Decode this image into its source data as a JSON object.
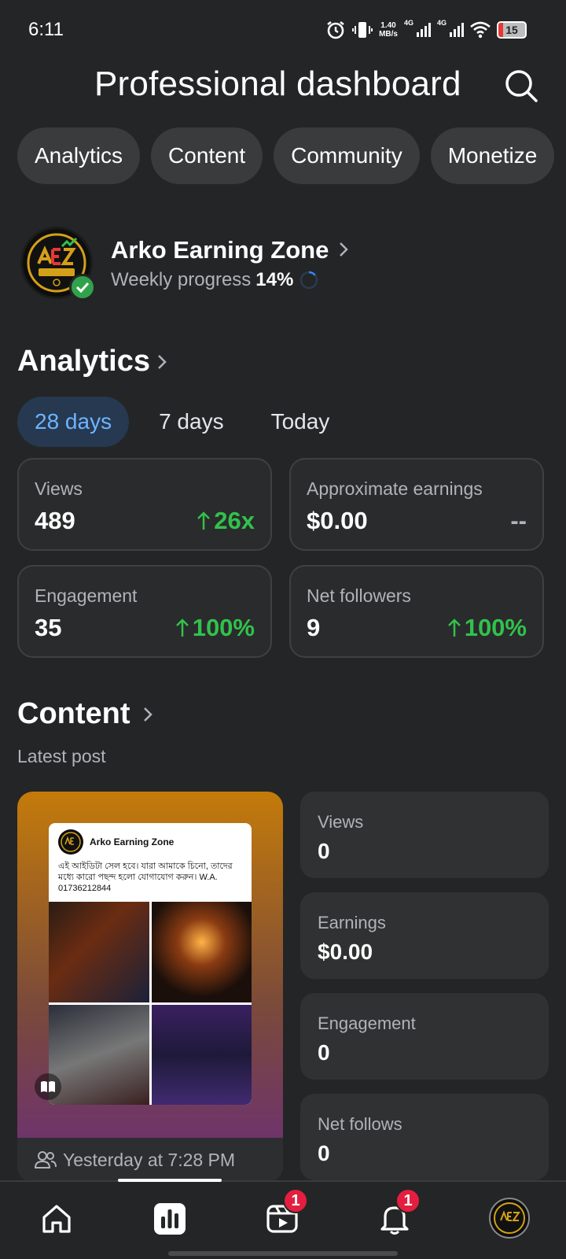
{
  "status_bar": {
    "time": "6:11",
    "net_speed": "1.40",
    "net_unit": "MB/s",
    "sim1": "4G",
    "sim2": "4G",
    "battery": "15"
  },
  "header": {
    "title": "Professional dashboard",
    "search_icon": "search-icon"
  },
  "chips": [
    "Analytics",
    "Content",
    "Community",
    "Monetize"
  ],
  "profile": {
    "name": "Arko Earning Zone",
    "progress_label": "Weekly progress",
    "progress_value": "14%",
    "progress_fraction": 0.14,
    "logo_text": "AEZ ARKO EARNING ZONE"
  },
  "analytics": {
    "title": "Analytics",
    "ranges": [
      "28 days",
      "7 days",
      "Today"
    ],
    "active_range": "28 days",
    "metrics": [
      {
        "label": "Views",
        "value": "489",
        "change": "26x",
        "trend": "up"
      },
      {
        "label": "Approximate earnings",
        "value": "$0.00",
        "change": "--",
        "trend": "none"
      },
      {
        "label": "Engagement",
        "value": "35",
        "change": "100%",
        "trend": "up"
      },
      {
        "label": "Net followers",
        "value": "9",
        "change": "100%",
        "trend": "up"
      }
    ]
  },
  "content": {
    "title": "Content",
    "subtitle": "Latest post",
    "post": {
      "page_name": "Arko Earning Zone",
      "text": "এই আইডিটা সেল হবে। যারা আমাকে চিনো, তাদের মধ্যে কারো পছন্দ হলো যোগাযোগ করুন। W.A. 01736212844",
      "time": "Yesterday at 7:28 PM"
    },
    "stats": [
      {
        "label": "Views",
        "value": "0"
      },
      {
        "label": "Earnings",
        "value": "$0.00"
      },
      {
        "label": "Engagement",
        "value": "0"
      },
      {
        "label": "Net follows",
        "value": "0"
      }
    ]
  },
  "bottom_nav": {
    "items": [
      "home-icon",
      "dashboard-icon",
      "video-icon",
      "notifications-icon",
      "profile-avatar"
    ],
    "video_badge": "1",
    "notifications_badge": "1"
  },
  "colors": {
    "background": "#242526",
    "accent": "#6cb4ff",
    "positive": "#31c24c",
    "badge": "#e41e3f"
  }
}
